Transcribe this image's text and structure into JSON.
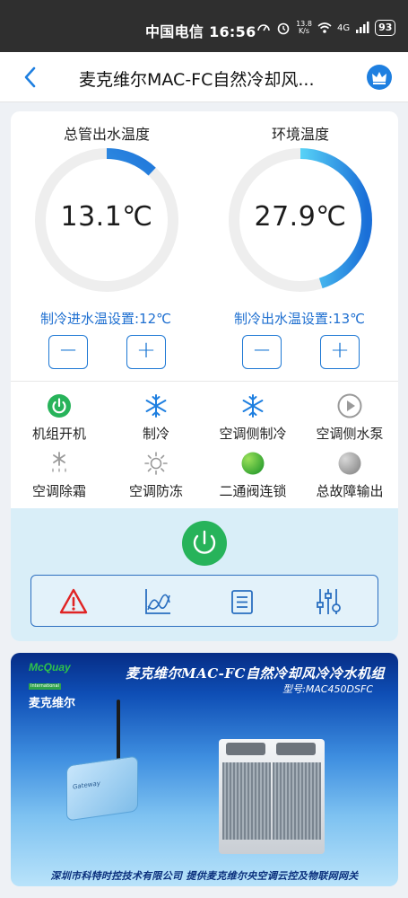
{
  "statusbar": {
    "carrier_time": "中国电信 16:56",
    "speed_top": "13.8",
    "speed_bottom": "K/s",
    "network": "4G",
    "battery": "93"
  },
  "navbar": {
    "title": "麦克维尔MAC-FC自然冷却风..."
  },
  "gauges": [
    {
      "title": "总管出水温度",
      "value": "13.1℃",
      "fill_fraction": 0.12
    },
    {
      "title": "环境温度",
      "value": "27.9℃",
      "fill_fraction": 0.45
    }
  ],
  "setpoints": [
    {
      "label": "制冷进水温设置:12℃",
      "minus": "−",
      "plus": "+"
    },
    {
      "label": "制冷出水温设置:13℃",
      "minus": "−",
      "plus": "+"
    }
  ],
  "status_items": [
    {
      "label": "机组开机",
      "icon": "power-icon",
      "color": "#27b35a"
    },
    {
      "label": "制冷",
      "icon": "snowflake-icon",
      "color": "#1e7fe0"
    },
    {
      "label": "空调侧制冷",
      "icon": "snowflake-icon",
      "color": "#1e7fe0"
    },
    {
      "label": "空调侧水泵",
      "icon": "play-icon",
      "color": "#9a9a9a"
    },
    {
      "label": "空调除霜",
      "icon": "defrost-icon",
      "color": "#9a9a9a"
    },
    {
      "label": "空调防冻",
      "icon": "sun-icon",
      "color": "#9a9a9a"
    },
    {
      "label": "二通阀连锁",
      "icon": "green-dot-icon",
      "color": "#55c23a"
    },
    {
      "label": "总故障输出",
      "icon": "gray-dot-icon",
      "color": "#a9a9a9"
    }
  ],
  "toolbar": {
    "tools": [
      "alarm-icon",
      "trend-chart-icon",
      "list-icon",
      "settings-sliders-icon"
    ]
  },
  "banner": {
    "brand_en": "McQuay",
    "brand_en_sub": "International",
    "brand_cn": "麦克维尔",
    "title": "麦克维尔MAC-FC自然冷却风冷冷水机组",
    "model": "型号:MAC450DSFC",
    "footer": "深圳市科特时控技术有限公司  提供麦克维尔央空调云控及物联网网关",
    "device_label": "Gateway"
  },
  "colors": {
    "accent": "#1e7fe0",
    "power_green": "#27b35a",
    "control_bg": "#d9eef8"
  }
}
